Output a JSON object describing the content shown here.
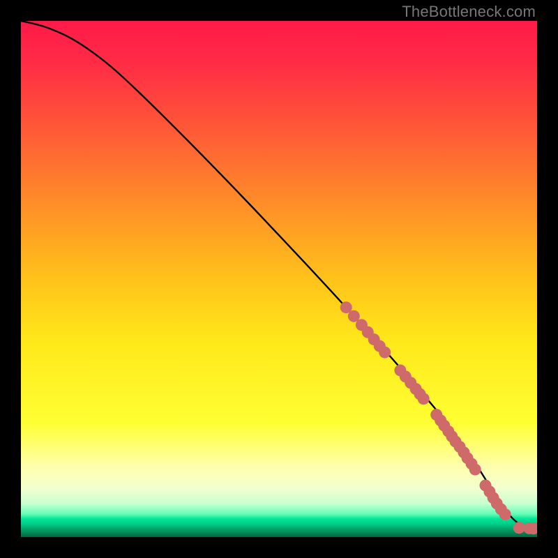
{
  "watermark": "TheBottleneck.com",
  "colors": {
    "bg": "#000000",
    "curve": "#000000",
    "marker": "#cf6a6a",
    "gradient_stops": [
      {
        "offset": 0.0,
        "color": "#ff1a48"
      },
      {
        "offset": 0.08,
        "color": "#ff2b46"
      },
      {
        "offset": 0.2,
        "color": "#ff5538"
      },
      {
        "offset": 0.35,
        "color": "#ff8c29"
      },
      {
        "offset": 0.5,
        "color": "#ffc21a"
      },
      {
        "offset": 0.62,
        "color": "#ffe81a"
      },
      {
        "offset": 0.78,
        "color": "#ffff33"
      },
      {
        "offset": 0.86,
        "color": "#ffffaa"
      },
      {
        "offset": 0.905,
        "color": "#f4ffd0"
      },
      {
        "offset": 0.935,
        "color": "#c8ffd0"
      },
      {
        "offset": 0.955,
        "color": "#66ffb8"
      },
      {
        "offset": 0.965,
        "color": "#00e596"
      },
      {
        "offset": 0.975,
        "color": "#00cc88"
      },
      {
        "offset": 0.985,
        "color": "#00a06a"
      },
      {
        "offset": 1.0,
        "color": "#00663f"
      }
    ]
  },
  "chart_data": {
    "type": "line",
    "title": "",
    "xlabel": "",
    "ylabel": "",
    "xlim": [
      0,
      100
    ],
    "ylim": [
      0,
      100
    ],
    "grid": false,
    "legend": false,
    "series": [
      {
        "name": "curve",
        "x": [
          0,
          3,
          6,
          10,
          15,
          20,
          30,
          40,
          50,
          60,
          70,
          78,
          82,
          85,
          88,
          90,
          92,
          94,
          96,
          98,
          100
        ],
        "y": [
          100,
          99.4,
          98.4,
          96.6,
          93.2,
          89.0,
          79.2,
          69.0,
          58.5,
          47.8,
          36.8,
          27.6,
          22.8,
          18.8,
          14.4,
          11.2,
          8.0,
          5.0,
          2.8,
          1.8,
          1.6
        ]
      },
      {
        "name": "markers",
        "type": "scatter",
        "x": [
          63,
          64.5,
          66,
          67.2,
          68.4,
          69.5,
          70.5,
          73.5,
          74.5,
          75.5,
          76.5,
          77.3,
          78,
          80.5,
          81.3,
          82,
          82.8,
          83.5,
          84.2,
          85,
          85.8,
          86.5,
          87.3,
          88,
          90,
          90.8,
          91.5,
          92.2,
          93,
          93.8,
          96.5,
          98.5,
          99.3
        ],
        "y": [
          44.5,
          42.8,
          41.1,
          39.7,
          38.3,
          37.0,
          35.8,
          32.3,
          31.1,
          29.9,
          28.7,
          27.7,
          26.8,
          23.7,
          22.6,
          21.6,
          20.5,
          19.5,
          18.5,
          17.5,
          16.4,
          15.3,
          14.2,
          13.1,
          10.0,
          8.8,
          7.6,
          6.5,
          5.4,
          4.4,
          1.8,
          1.7,
          1.65
        ]
      }
    ]
  }
}
